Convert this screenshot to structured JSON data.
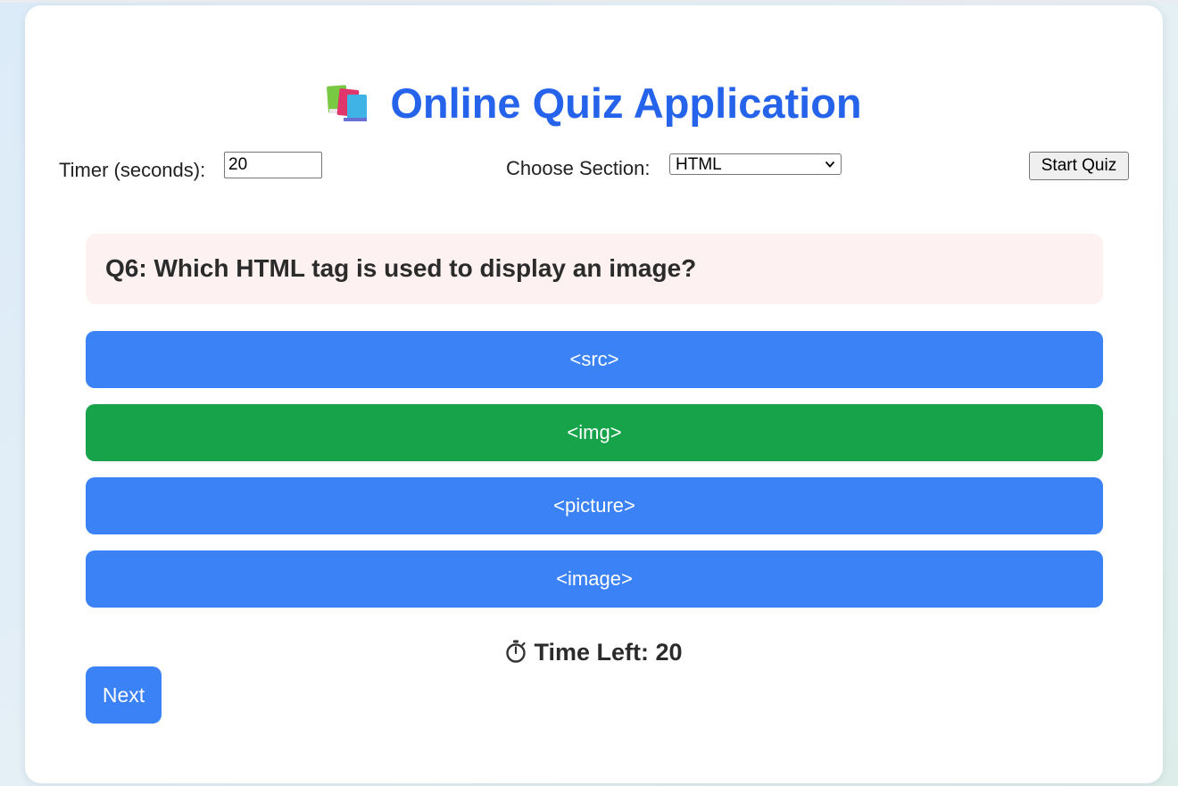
{
  "app": {
    "title": "Online Quiz Application",
    "title_icon": "books-icon",
    "accent_color": "#2563eb"
  },
  "controls": {
    "timer_label": "Timer (seconds):",
    "timer_value": "20",
    "section_label": "Choose Section:",
    "section_selected": "HTML",
    "start_label": "Start Quiz"
  },
  "question": {
    "text": "Q6: Which HTML tag is used to display an image?"
  },
  "options": [
    {
      "label": "<src>",
      "state": "default",
      "color": "#3b82f6"
    },
    {
      "label": "<img>",
      "state": "correct",
      "color": "#16a34a"
    },
    {
      "label": "<picture>",
      "state": "default",
      "color": "#3b82f6"
    },
    {
      "label": "<image>",
      "state": "default",
      "color": "#3b82f6"
    }
  ],
  "timer": {
    "icon": "stopwatch-icon",
    "text": "Time Left: 20"
  },
  "next_label": "Next"
}
